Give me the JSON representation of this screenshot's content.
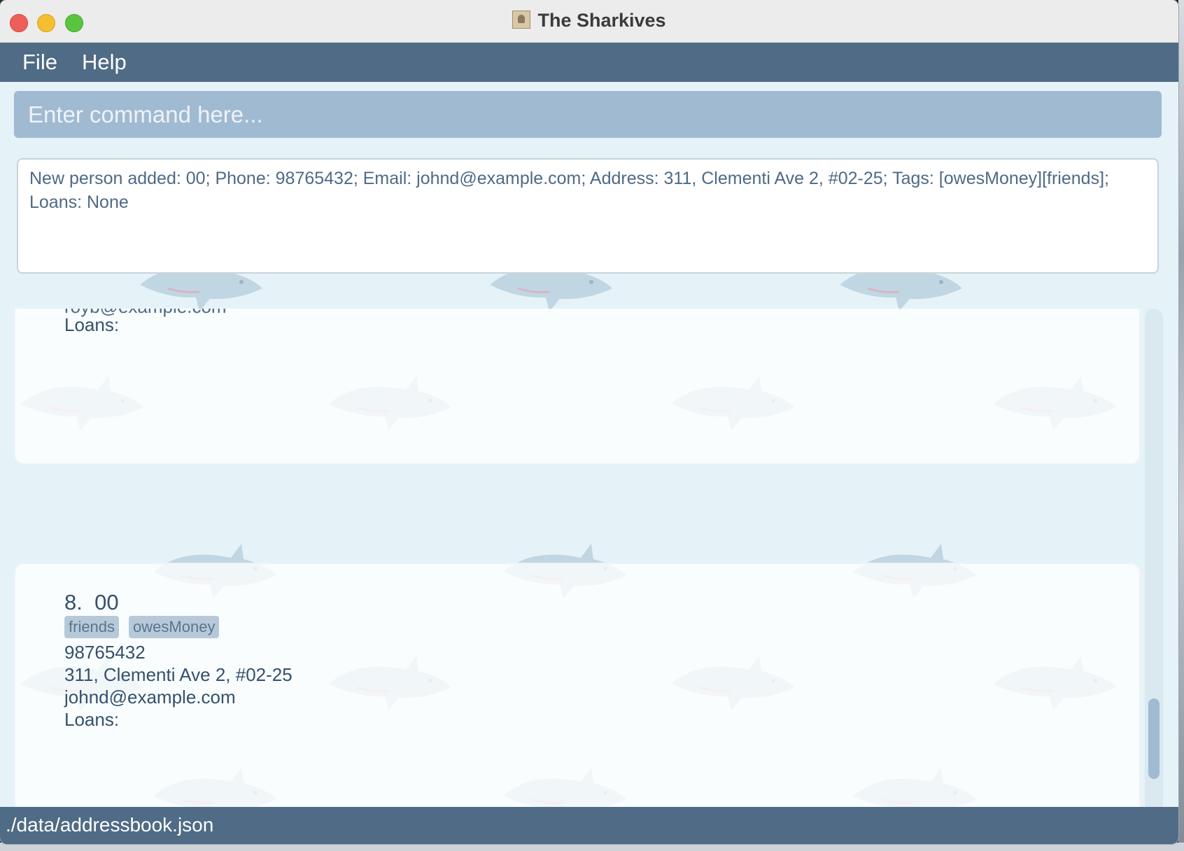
{
  "window": {
    "title": "The Sharkives"
  },
  "menu": {
    "items": [
      "File",
      "Help"
    ]
  },
  "command": {
    "placeholder": "Enter command here...",
    "value": ""
  },
  "result": {
    "text": "New person added: 00; Phone: 98765432; Email: johnd@example.com; Address: 311, Clementi Ave 2, #02-25; Tags: [owesMoney][friends]; Loans: None"
  },
  "person_list": {
    "previous_card": {
      "email_partial": "royb@example.com",
      "loans_label": "Loans:"
    },
    "current_card": {
      "index": "8.",
      "name": "00",
      "tags": [
        "friends",
        "owesMoney"
      ],
      "phone": "98765432",
      "address": "311, Clementi Ave 2, #02-25",
      "email": "johnd@example.com",
      "loans_label": "Loans:"
    }
  },
  "status": {
    "file_path": "./data/addressbook.json"
  },
  "colors": {
    "menubar": "#4f6b85",
    "command_box": "#a0bad2",
    "tag_bg": "#b7c9d9",
    "text": "#35506b"
  }
}
